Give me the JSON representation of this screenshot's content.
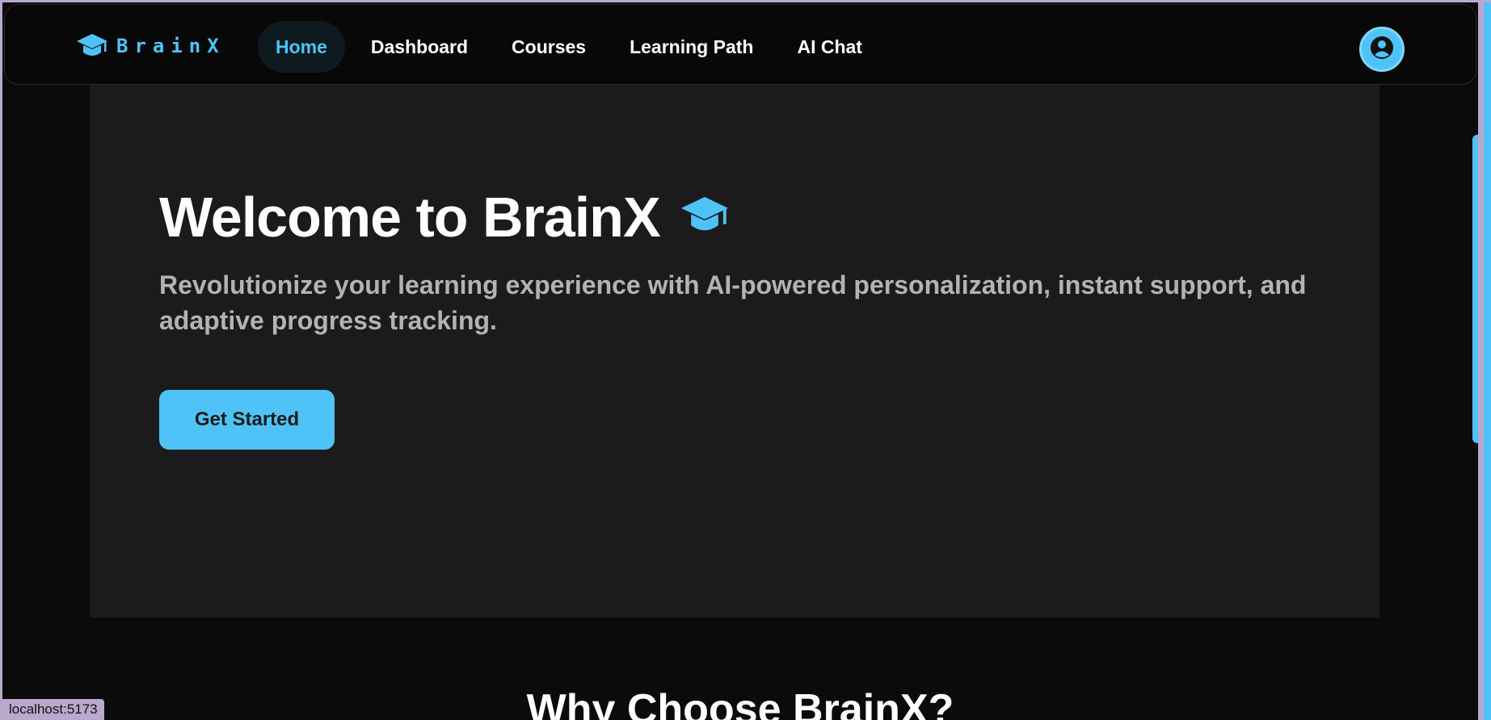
{
  "app": {
    "logo_text": "BrainX"
  },
  "nav": {
    "items": [
      {
        "label": "Home",
        "active": true
      },
      {
        "label": "Dashboard",
        "active": false
      },
      {
        "label": "Courses",
        "active": false
      },
      {
        "label": "Learning Path",
        "active": false
      },
      {
        "label": "AI Chat",
        "active": false
      }
    ]
  },
  "hero": {
    "title": "Welcome to BrainX",
    "subtitle": "Revolutionize your learning experience with AI-powered personalization, instant support, and adaptive progress tracking.",
    "cta_label": "Get Started"
  },
  "features": {
    "title": "Why Choose BrainX?"
  },
  "status_bar": {
    "url": "localhost:5173"
  },
  "colors": {
    "accent": "#4fc3f7",
    "background": "#0b0b0b",
    "hero_background": "#1b1b1b"
  },
  "icons": {
    "logo": "graduation-cap-icon",
    "hero": "graduation-cap-icon",
    "profile": "user-circle-icon"
  }
}
